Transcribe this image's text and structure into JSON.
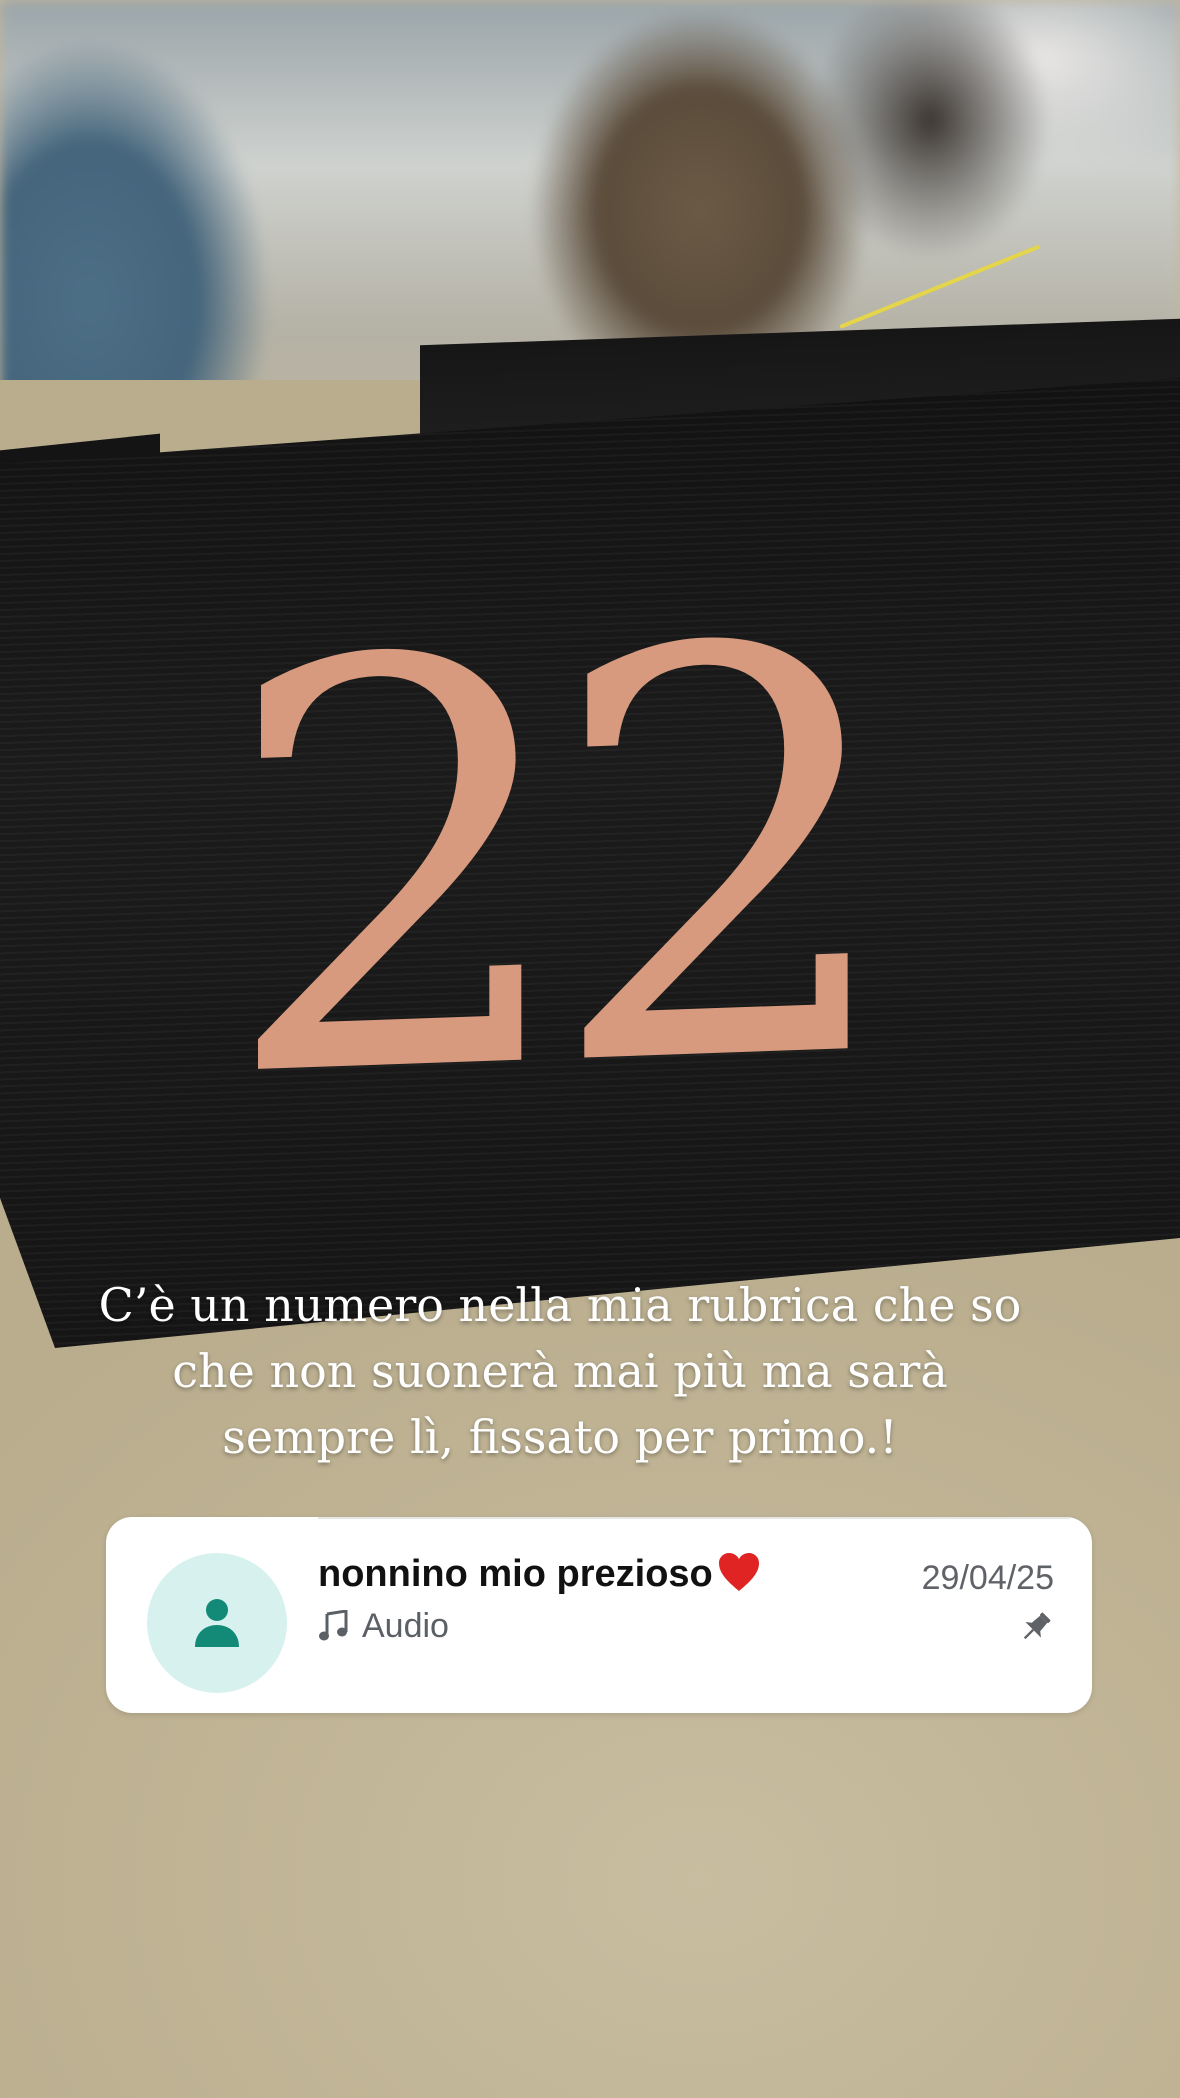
{
  "story": {
    "table_number": "22",
    "caption_lines": [
      "C’è un numero nella mia rubrica che so",
      "che non suonerà mai più ma sarà",
      "sempre lì, fissato per primo.!"
    ]
  },
  "contact_card": {
    "name": "nonnino mio prezioso",
    "name_emoji_icon": "red-heart-icon",
    "last_message_icon": "music-note-icon",
    "last_message": "Audio",
    "date": "29/04/25",
    "avatar_icon": "person-icon",
    "status_icon": "pin-icon",
    "colors": {
      "avatar_bg": "#d6f1ee",
      "avatar_fg": "#138a78",
      "heart": "#e02424",
      "secondary_text": "#5f6368"
    }
  }
}
